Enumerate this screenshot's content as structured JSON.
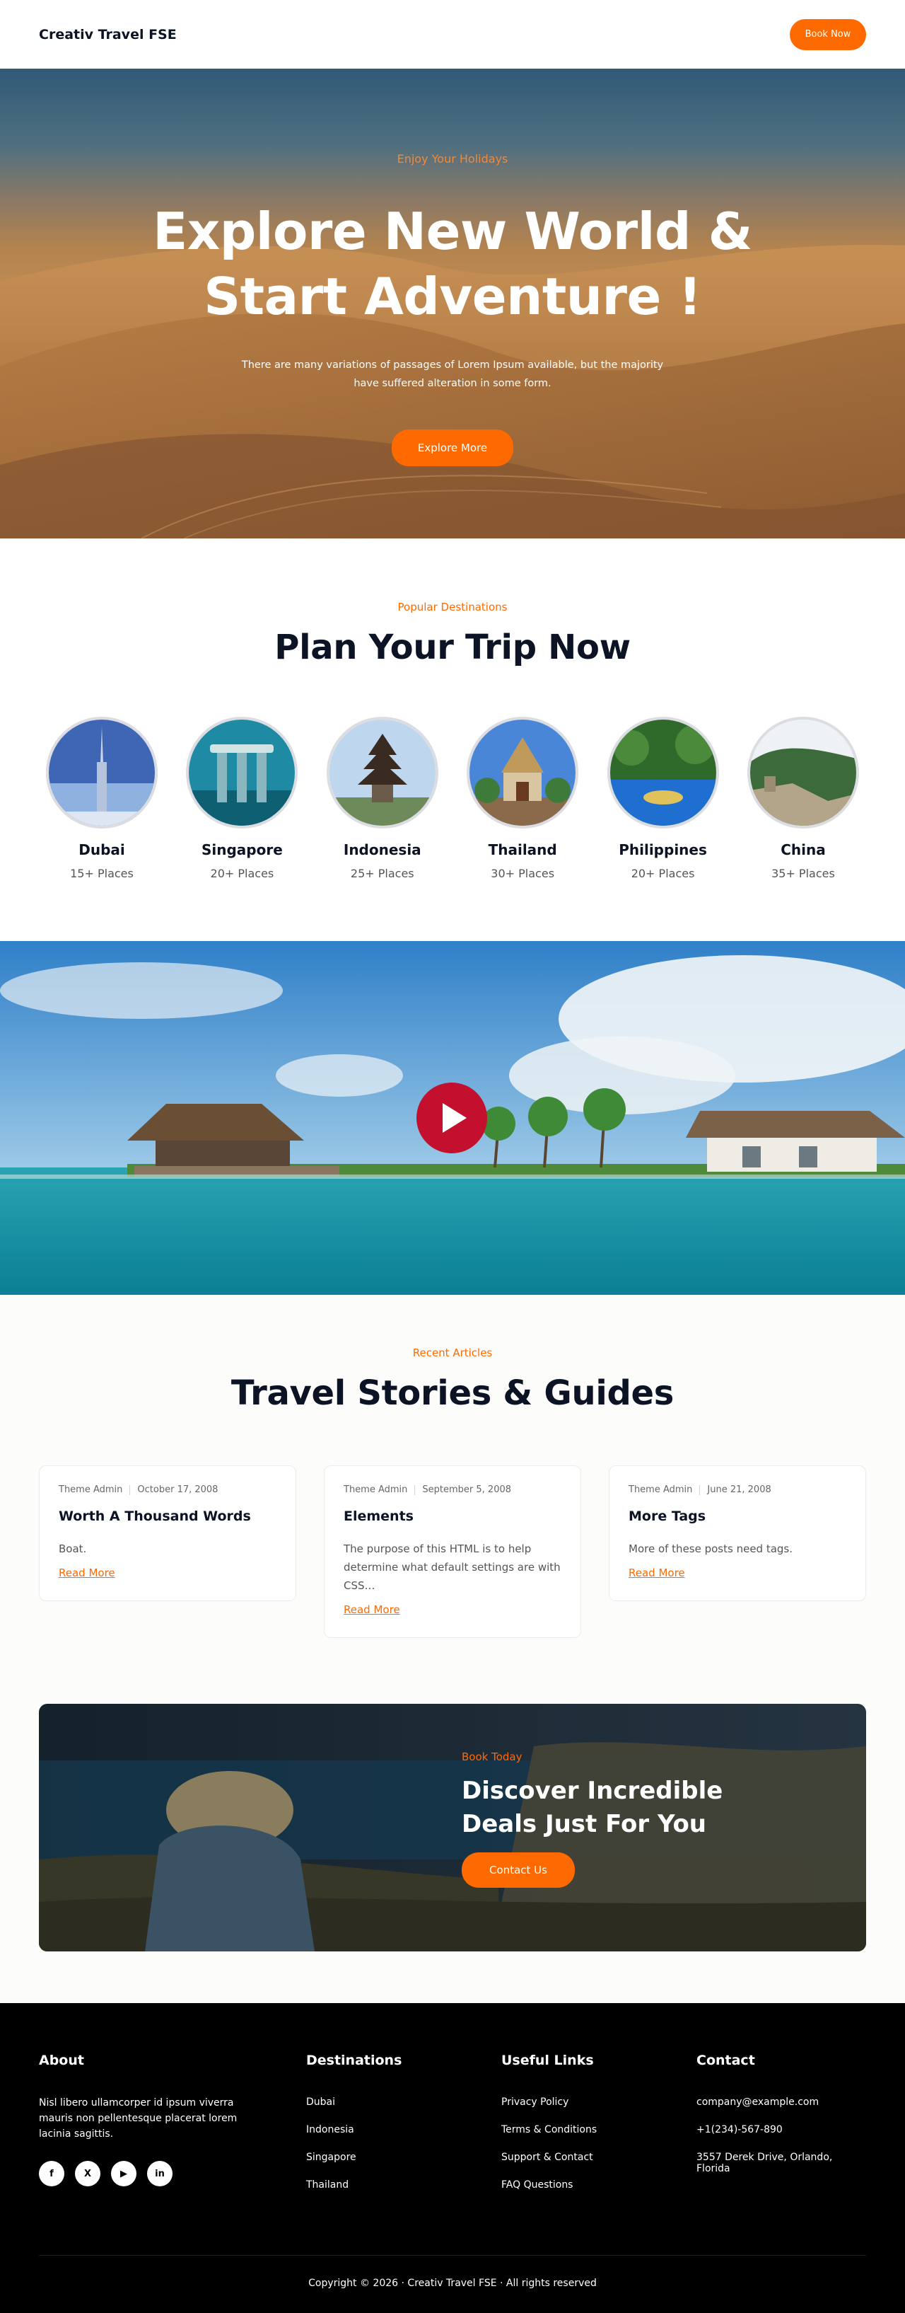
{
  "header": {
    "logo": "Creativ Travel FSE",
    "cta": "Book Now"
  },
  "hero": {
    "eyebrow": "Enjoy Your Holidays",
    "title_line1": "Explore New World &",
    "title_line2": "Start Adventure !",
    "description": "There are many variations of passages of Lorem Ipsum available, but the majority have suffered alteration in some form.",
    "cta": "Explore More"
  },
  "destinations": {
    "eyebrow": "Popular Destinations",
    "title": "Plan Your Trip Now",
    "items": [
      {
        "name": "Dubai",
        "count": "15+ Places"
      },
      {
        "name": "Singapore",
        "count": "20+ Places"
      },
      {
        "name": "Indonesia",
        "count": "25+ Places"
      },
      {
        "name": "Thailand",
        "count": "30+ Places"
      },
      {
        "name": "Philippines",
        "count": "20+ Places"
      },
      {
        "name": "China",
        "count": "35+ Places"
      }
    ]
  },
  "video": {
    "play_icon": "play-icon"
  },
  "articles": {
    "eyebrow": "Recent Articles",
    "title": "Travel Stories & Guides",
    "items": [
      {
        "author": "Theme Admin",
        "date": "October 17, 2008",
        "title": "Worth A Thousand Words",
        "excerpt": "Boat.",
        "read_more": "Read More"
      },
      {
        "author": "Theme Admin",
        "date": "September 5, 2008",
        "title": "Elements",
        "excerpt": "The purpose of this HTML is to help determine what default settings are with CSS…",
        "read_more": "Read More"
      },
      {
        "author": "Theme Admin",
        "date": "June 21, 2008",
        "title": "More Tags",
        "excerpt": "More of these posts need tags.",
        "read_more": "Read More"
      }
    ]
  },
  "deals": {
    "eyebrow": "Book Today",
    "title_line1": "Discover Incredible",
    "title_line2": "Deals Just For You",
    "cta": "Contact Us"
  },
  "footer": {
    "about": {
      "heading": "About",
      "text": "Nisl libero ullamcorper id ipsum viverra mauris non pellentesque placerat lorem lacinia sagittis.",
      "socials": [
        "facebook-icon",
        "x-icon",
        "youtube-icon",
        "linkedin-icon"
      ]
    },
    "destinations": {
      "heading": "Destinations",
      "links": [
        "Dubai",
        "Indonesia",
        "Singapore",
        "Thailand"
      ]
    },
    "useful": {
      "heading": "Useful Links",
      "links": [
        "Privacy Policy",
        "Terms & Conditions",
        "Support & Contact",
        "FAQ Questions"
      ]
    },
    "contact": {
      "heading": "Contact",
      "lines": [
        "company@example.com",
        "+1(234)-567-890",
        "3557 Derek Drive, Orlando, Florida"
      ]
    },
    "copyright": "Copyright © 2026 ·  Creativ Travel FSE  · All rights reserved"
  },
  "colors": {
    "accent": "#ff6a00",
    "play": "#c2102e",
    "dark": "#0b1324"
  }
}
